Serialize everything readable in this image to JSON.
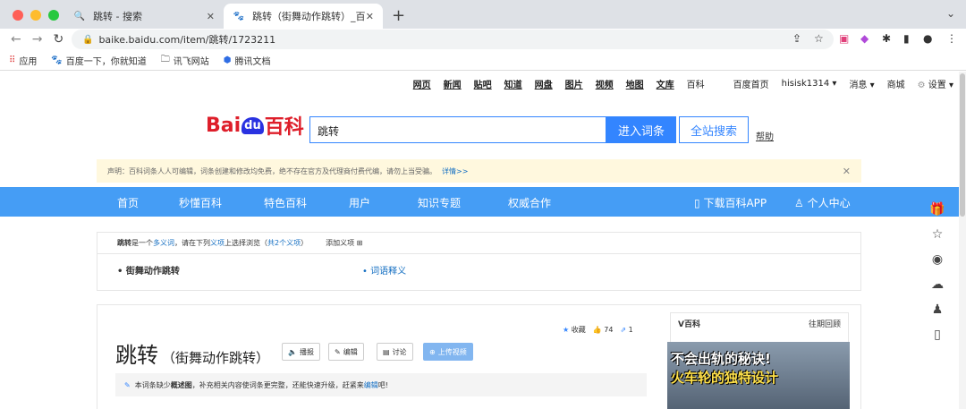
{
  "browser": {
    "tabs": [
      {
        "title": "跳转 - 搜索"
      },
      {
        "title": "跳转（街舞动作跳转）_百度百科"
      }
    ],
    "url": "baike.baidu.com/item/跳转/1723211",
    "bookmarks": [
      "应用",
      "百度一下，你就知道",
      "讯飞网站",
      "腾讯文档"
    ]
  },
  "topnav": {
    "links": [
      "网页",
      "新闻",
      "贴吧",
      "知道",
      "网盘",
      "图片",
      "视频",
      "地图",
      "文库"
    ],
    "plain": [
      "百科",
      "百度首页",
      "hisisk1314",
      "消息",
      "商城",
      "设置"
    ]
  },
  "logo": {
    "text": "Bai",
    "du": "du",
    "baike": "百科"
  },
  "search": {
    "value": "跳转",
    "enter_btn": "进入词条",
    "all_btn": "全站搜索",
    "help": "帮助"
  },
  "notice": {
    "text": "声明：百科词条人人可编辑，词条创建和修改均免费，绝不存在官方及代理商付费代编，请勿上当受骗。",
    "more": "详情>>"
  },
  "bluenav": {
    "items": [
      "首页",
      "秒懂百科",
      "特色百科",
      "用户",
      "知识专题",
      "权威合作"
    ],
    "download": "下载百科APP",
    "user_center": "个人中心"
  },
  "polysemy": {
    "term": "跳转",
    "is_polysemy": "是一个",
    "polysemy_word": "多义词",
    "choose": "，请在下列",
    "item": "义项",
    "browse": "上选择浏览（",
    "count": "共2个义项",
    "close": "）",
    "add": "添加义项",
    "options": [
      "街舞动作跳转",
      "词语释义"
    ]
  },
  "article": {
    "title": "跳转",
    "subtitle": "（街舞动作跳转）",
    "buttons": [
      "播报",
      "编辑",
      "讨论",
      "上传视频"
    ],
    "collect": "收藏",
    "likes": "74",
    "shares": "1",
    "hint_pre": "本词条缺少",
    "hint_bold": "概述图",
    "hint_mid": "，补充相关内容使词条更完整，还能快速升级，赶紧来",
    "hint_link": "编辑",
    "hint_end": "吧!"
  },
  "vbaike": {
    "title": "V百科",
    "history": "往期回顾",
    "img_text1": "不会出轨的秘诀!",
    "img_text2": "火车轮的独特设计"
  },
  "colors": {
    "brand_blue": "#3385ff",
    "nav_blue": "#459df5",
    "baidu_red": "#de1e2a"
  }
}
